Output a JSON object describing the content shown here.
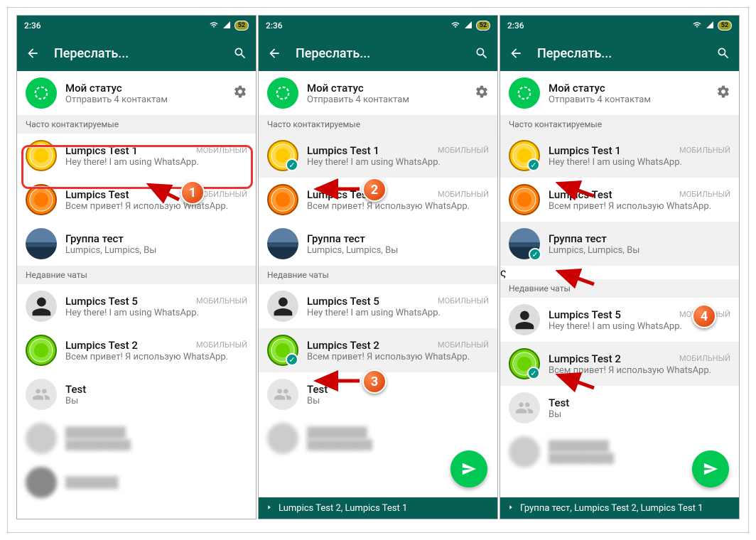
{
  "statusbar": {
    "time": "2:36",
    "battery": "52"
  },
  "header": {
    "title": "Переслать..."
  },
  "status_row": {
    "title": "Мой статус",
    "subtitle": "Отправить 4 контактам"
  },
  "sections": {
    "frequent": "Часто контактируемые",
    "recent": "Недавние чаты"
  },
  "tag_mobile": "МОБИЛЬНЫЙ",
  "contacts": {
    "c1": {
      "name": "Lumpics Test 1",
      "sub": "Hey there! I am using WhatsApp."
    },
    "c2": {
      "name": "Lumpics Test",
      "sub": "Всем привет! Я использую WhatsApp."
    },
    "g1": {
      "name": "Группа тест",
      "sub": "Lumpics, Lumpics, Вы"
    },
    "c5": {
      "name": "Lumpics Test 5",
      "sub": "Hey there! I am using WhatsApp."
    },
    "c3": {
      "name": "Lumpics Test 2",
      "sub": "Всем привет! Я использую WhatsApp."
    },
    "t1": {
      "name": "Test",
      "sub": "Вы"
    }
  },
  "footer": {
    "panel2": "Lumpics Test 2, Lumpics Test 1",
    "panel3": "Группа тест, Lumpics Test 2, Lumpics Test 1"
  },
  "annotations": {
    "n1": "1",
    "n2": "2",
    "n3": "3",
    "n4": "4"
  }
}
